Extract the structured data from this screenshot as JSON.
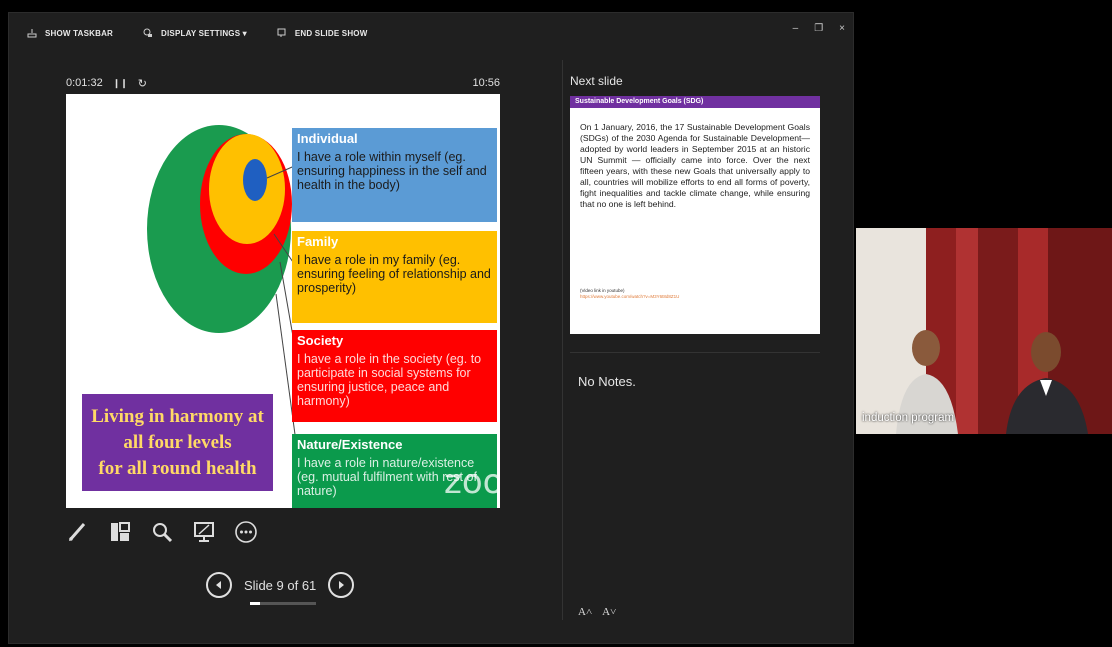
{
  "toolbar": {
    "show_taskbar": "SHOW TASKBAR",
    "display_settings": "DISPLAY SETTINGS ▾",
    "end_slide_show": "END SLIDE SHOW"
  },
  "window_controls": {
    "minimize": "–",
    "restore": "❐",
    "close": "×"
  },
  "timer": {
    "elapsed": "0:01:32",
    "pause_glyph": "❙❙",
    "reset_glyph": "↻",
    "clock": "10:56"
  },
  "slide": {
    "levels": [
      {
        "title": "Individual",
        "desc": "I have a role within myself (eg. ensuring happiness in the self and health in the body)"
      },
      {
        "title": "Family",
        "desc": "I have a role in my family (eg. ensuring feeling of relationship and prosperity)"
      },
      {
        "title": "Society",
        "desc": "I have a role in the society (eg. to participate in social systems for ensuring justice, peace and harmony)"
      },
      {
        "title": "Nature/Existence",
        "desc": "I have a role in nature/existence (eg. mutual fulfilment with rest of nature)"
      }
    ],
    "harmony": {
      "line1": "Living in harmony at",
      "line2": "all four levels",
      "line3": "for all round health"
    },
    "watermark": "zoom",
    "colors": {
      "green": "#1a9b4f",
      "red": "#ff0000",
      "yellow": "#ffc000",
      "blue": "#1f5fc1",
      "purple": "#7030a0"
    }
  },
  "tools": [
    "pen-icon",
    "slides-grid-icon",
    "magnifier-icon",
    "screen-icon",
    "more-icon"
  ],
  "navigation": {
    "slide_text": "Slide 9 of 61",
    "current": 9,
    "total": 61
  },
  "next_slide": {
    "label": "Next slide",
    "header": "Sustainable Development Goals (SDG)",
    "body": "On 1 January, 2016, the 17 Sustainable Development Goals (SDGs) of the 2030 Agenda for Sustainable Development—adopted by world leaders in September 2015 at an historic UN Summit — officially came into force.  Over the next fifteen years, with these new Goals that universally apply to all, countries will mobilize efforts to end all forms of poverty, fight inequalities and tackle climate change, while ensuring that no one is left behind.",
    "video_label": "(Video link in youtube)",
    "video_link": "https://www.youtube.com/watch?v=M3Y6t8d8Z1U"
  },
  "notes": {
    "text": "No Notes.",
    "increase_font": "A˄",
    "decrease_font": "A˅"
  },
  "video": {
    "participant_name": "induction program"
  }
}
